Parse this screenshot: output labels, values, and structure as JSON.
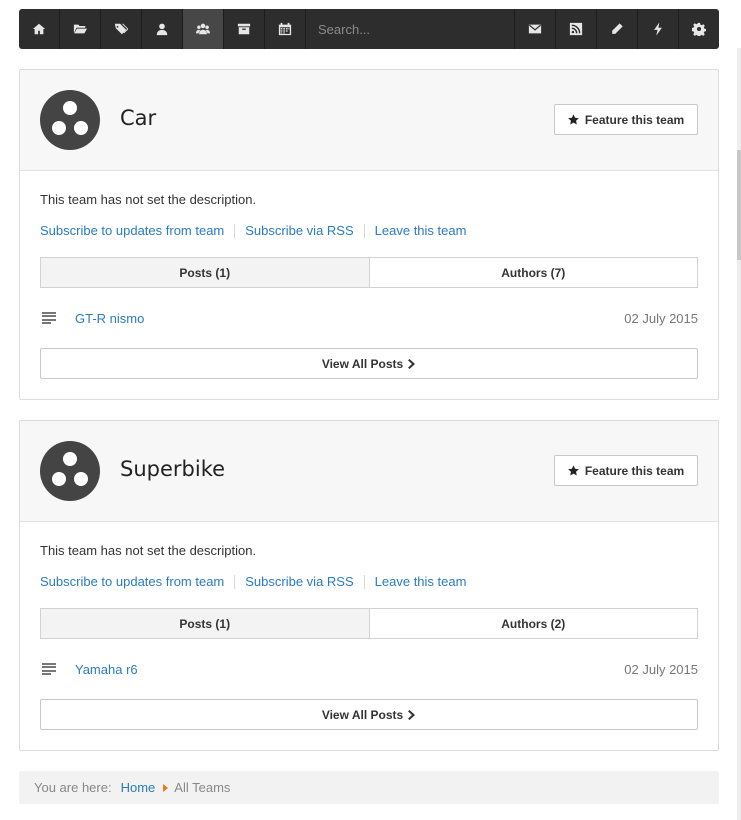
{
  "toolbar": {
    "left_icons": [
      "home-icon",
      "folder-open-icon",
      "tags-icon",
      "user-icon",
      "users-icon",
      "archive-icon",
      "calendar-icon"
    ],
    "active_icon": "users-icon",
    "search_placeholder": "Search...",
    "right_icons": [
      "envelope-icon",
      "rss-icon",
      "pencil-icon",
      "bolt-icon",
      "gear-icon"
    ]
  },
  "teams": [
    {
      "name": "Car",
      "feature_label": "Feature this team",
      "description": "This team has not set the description.",
      "links": [
        "Subscribe to updates from team",
        "Subscribe via RSS",
        "Leave this team"
      ],
      "tabs": [
        "Posts (1)",
        "Authors (7)"
      ],
      "active_tab": 0,
      "post": {
        "title": "GT-R nismo",
        "date": "02 July 2015"
      },
      "view_all_label": "View All Posts"
    },
    {
      "name": "Superbike",
      "feature_label": "Feature this team",
      "description": "This team has not set the description.",
      "links": [
        "Subscribe to updates from team",
        "Subscribe via RSS",
        "Leave this team"
      ],
      "tabs": [
        "Posts (1)",
        "Authors (2)"
      ],
      "active_tab": 0,
      "post": {
        "title": "Yamaha r6",
        "date": "02 July 2015"
      },
      "view_all_label": "View All Posts"
    }
  ],
  "breadcrumb": {
    "label": "You are here:",
    "home": "Home",
    "current": "All Teams",
    "caret_color": "#e37b1c"
  },
  "colors": {
    "toolbar_bg": "#2d2d2d",
    "link": "#2a7bbf"
  }
}
